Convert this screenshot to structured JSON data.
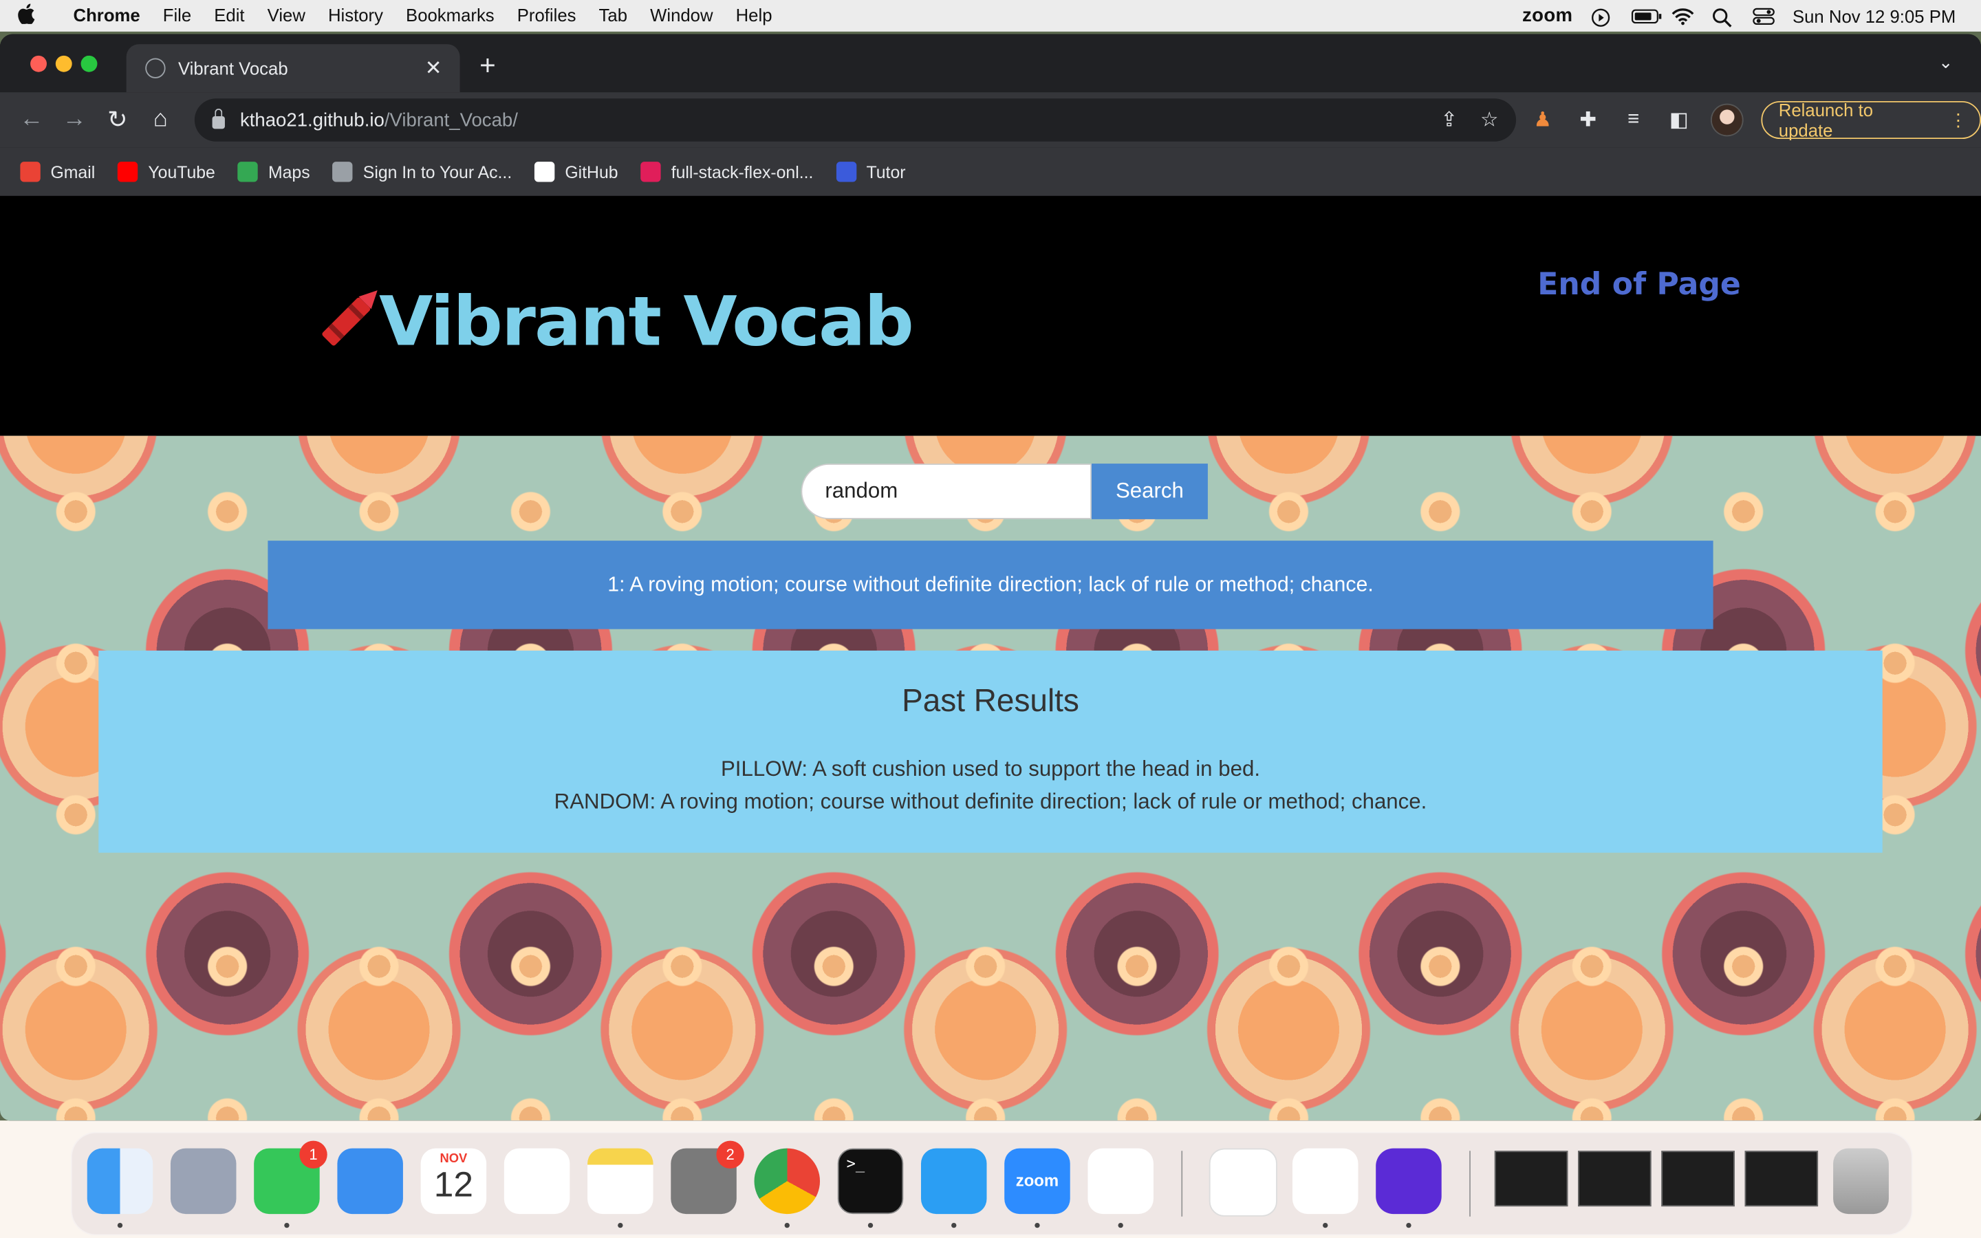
{
  "menubar": {
    "app_name": "Chrome",
    "menus": [
      "File",
      "Edit",
      "View",
      "History",
      "Bookmarks",
      "Profiles",
      "Tab",
      "Window",
      "Help"
    ],
    "zoom_label": "zoom",
    "datetime": "Sun Nov 12  9:05 PM"
  },
  "browser": {
    "tab_title": "Vibrant Vocab",
    "url_host": "kthao21.github.io",
    "url_path": "/Vibrant_Vocab/",
    "relaunch_label": "Relaunch to update",
    "bookmarks": [
      {
        "label": "Gmail",
        "icon": "gmail-icon",
        "color": "#ea4335"
      },
      {
        "label": "YouTube",
        "icon": "youtube-icon",
        "color": "#ff0000"
      },
      {
        "label": "Maps",
        "icon": "maps-icon",
        "color": "#34a853"
      },
      {
        "label": "Sign In to Your Ac...",
        "icon": "globe-icon",
        "color": "#9aa0a6"
      },
      {
        "label": "GitHub",
        "icon": "github-icon",
        "color": "#ffffff"
      },
      {
        "label": "full-stack-flex-onl...",
        "icon": "slack-icon",
        "color": "#e01e5a"
      },
      {
        "label": "Tutor",
        "icon": "tutor-icon",
        "color": "#3b5bdb"
      }
    ]
  },
  "page": {
    "logo_text": "Vibrant Vocab",
    "end_link": "End of Page",
    "search_value": "random",
    "search_button": "Search",
    "definition": "1: A roving motion; course without definite direction; lack of rule or method; chance.",
    "past_title": "Past Results",
    "past_results": [
      "PILLOW: A soft cushion used to support the head in bed.",
      "RANDOM: A roving motion; course without definite direction; lack of rule or method; chance."
    ]
  },
  "dock": {
    "calendar_month": "NOV",
    "calendar_day": "12",
    "messages_badge": "1",
    "settings_badge": "2",
    "zoom_label": "zoom"
  },
  "colors": {
    "logo": "#7ed0ea",
    "end_link": "#4e6bd1",
    "search_button": "#4a8ad2",
    "definition_bg": "#4a8ad2",
    "past_bg": "#87d3f3"
  }
}
